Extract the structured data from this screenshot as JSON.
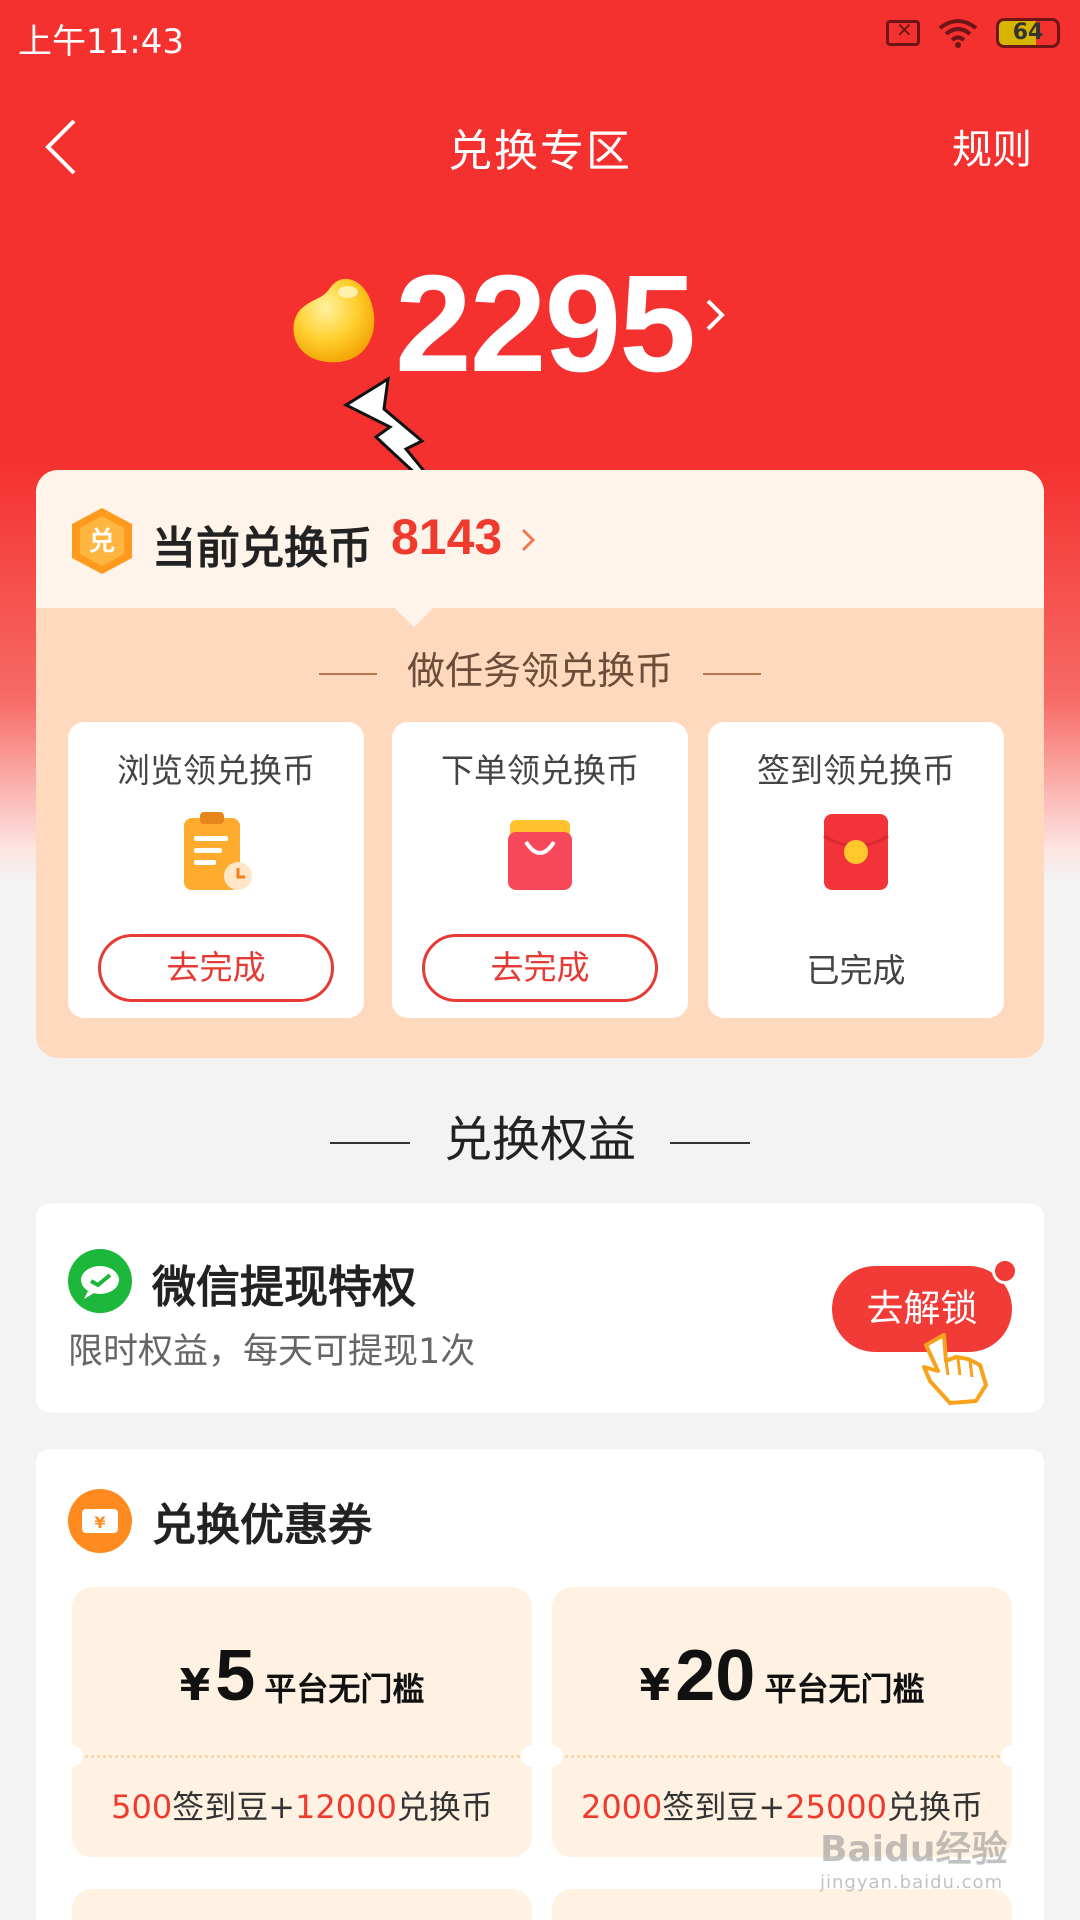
{
  "status_bar": {
    "time": "上午11:43",
    "battery": "64",
    "battery_level": 0.64
  },
  "nav": {
    "title": "兑换专区",
    "rules": "规则"
  },
  "balance": {
    "value": "2295"
  },
  "exchange_coins": {
    "label": "当前兑换币",
    "value": "8143"
  },
  "tasks": {
    "heading": "做任务领兑换币",
    "items": [
      {
        "title": "浏览领兑换币",
        "icon": "clipboard-clock-icon",
        "action": "去完成"
      },
      {
        "title": "下单领兑换币",
        "icon": "shopping-bag-icon",
        "action": "去完成"
      },
      {
        "title": "签到领兑换币",
        "icon": "red-envelope-icon",
        "status": "已完成"
      }
    ]
  },
  "benefits": {
    "heading": "兑换权益"
  },
  "wechat": {
    "title": "微信提现特权",
    "subtitle": "限时权益，每天可提现1次",
    "button": "去解锁"
  },
  "coupons": {
    "title": "兑换优惠券",
    "items": [
      {
        "symbol": "¥",
        "amount": "5",
        "desc": "平台无门槛",
        "beans": "500",
        "beans_unit": "签到豆+",
        "coins": "12000",
        "coins_unit": "兑换币"
      },
      {
        "symbol": "¥",
        "amount": "20",
        "desc": "平台无门槛",
        "beans": "2000",
        "beans_unit": "签到豆+",
        "coins": "25000",
        "coins_unit": "兑换币"
      }
    ]
  },
  "watermark": {
    "main": "Baidu经验",
    "sub": "jingyan.baidu.com"
  },
  "colors": {
    "primary_red": "#f4312f",
    "accent_orange": "#fed9bd",
    "coupon_bg": "#fff2e3"
  }
}
